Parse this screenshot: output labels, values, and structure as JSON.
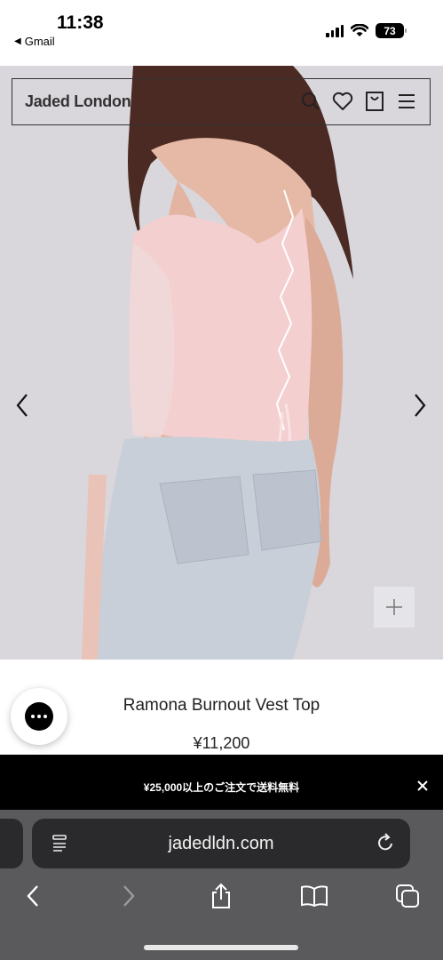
{
  "status_bar": {
    "time": "11:38",
    "back_app": "Gmail",
    "battery": "73"
  },
  "header": {
    "brand": "Jaded London",
    "icons": [
      "search-icon",
      "heart-icon",
      "bag-icon",
      "menu-icon"
    ]
  },
  "gallery": {
    "prev_icon": "chevron-left-icon",
    "next_icon": "chevron-right-icon",
    "zoom_icon": "plus-icon"
  },
  "product": {
    "title": "Ramona Burnout Vest Top",
    "price": "¥11,200"
  },
  "promo": {
    "text": "¥25,000以上のご注文で送料無料"
  },
  "browser": {
    "url": "jadedldn.com",
    "toolbar": [
      "back-icon",
      "forward-icon",
      "share-icon",
      "bookmarks-icon",
      "tabs-icon"
    ]
  },
  "colors": {
    "photo_bg": "#d9d6dc",
    "top_pink": "#f4cfd0",
    "jeans": "#c9cfd8",
    "promo_bg": "#000000",
    "safari_bg": "#5a5a5c"
  }
}
